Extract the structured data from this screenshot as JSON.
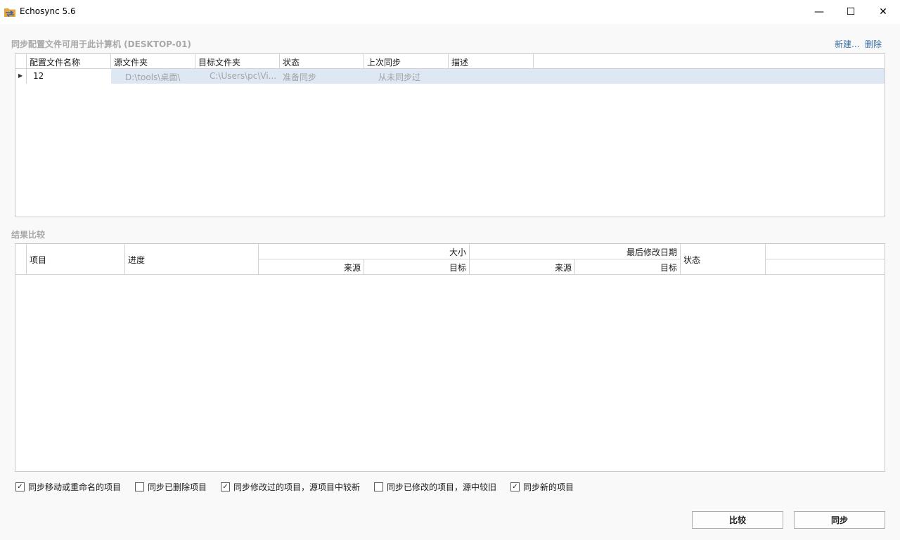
{
  "window": {
    "title": "Echosync 5.6",
    "minimize_glyph": "—",
    "maximize_glyph": "☐",
    "close_glyph": "✕"
  },
  "profiles": {
    "section_label": "同步配置文件可用于此计算机 (DESKTOP-01)",
    "new_link": "新建...",
    "delete_link": "删除",
    "columns": [
      "配置文件名称",
      "源文件夹",
      "目标文件夹",
      "状态",
      "上次同步",
      "描述"
    ],
    "rows": [
      {
        "name": "12",
        "source": "D:\\tools\\桌面\\",
        "target": "C:\\Users\\pc\\Vi...",
        "status": "准备同步",
        "last_sync": "从未同步过",
        "description": ""
      }
    ]
  },
  "results": {
    "section_label": "结果比较",
    "col_item": "项目",
    "col_progress": "进度",
    "group_size": "大小",
    "group_modified": "最后修改日期",
    "sub_source": "来源",
    "sub_target": "目标",
    "col_status": "状态"
  },
  "options": [
    {
      "label": "同步移动或重命名的项目",
      "checked": true
    },
    {
      "label": "同步已删除项目",
      "checked": false
    },
    {
      "label": "同步修改过的项目，源项目中较新",
      "checked": true
    },
    {
      "label": "同步已修改的项目，源中较旧",
      "checked": false
    },
    {
      "label": "同步新的项目",
      "checked": true
    }
  ],
  "buttons": {
    "compare": "比较",
    "sync": "同步"
  },
  "colors": {
    "selected_row": "#dde8f4",
    "link": "#3a6ea5",
    "section_label": "#a8a8a8"
  }
}
